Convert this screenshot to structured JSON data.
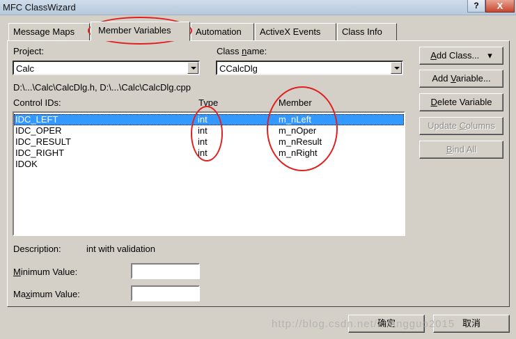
{
  "window": {
    "title": "MFC ClassWizard",
    "help_label": "?",
    "close_label": "X"
  },
  "tabs": [
    {
      "label": "Message Maps"
    },
    {
      "label": "Member Variables",
      "active": true
    },
    {
      "label": "Automation"
    },
    {
      "label": "ActiveX Events"
    },
    {
      "label": "Class Info"
    }
  ],
  "project": {
    "label": "Project:",
    "value": "Calc"
  },
  "class_name": {
    "label_prefix": "Class ",
    "label_accel": "n",
    "label_suffix": "ame:",
    "value": "CCalcDlg"
  },
  "file_path": "D:\\...\\Calc\\CalcDlg.h, D:\\...\\Calc\\CalcDlg.cpp",
  "list": {
    "headers": {
      "control_ids": "Control IDs:",
      "type": "Type",
      "member": "Member"
    },
    "rows": [
      {
        "id": "IDC_LEFT",
        "type": "int",
        "member": "m_nLeft",
        "selected": true
      },
      {
        "id": "IDC_OPER",
        "type": "int",
        "member": "m_nOper"
      },
      {
        "id": "IDC_RESULT",
        "type": "int",
        "member": "m_nResult"
      },
      {
        "id": "IDC_RIGHT",
        "type": "int",
        "member": "m_nRight"
      },
      {
        "id": "IDOK",
        "type": "",
        "member": ""
      }
    ]
  },
  "description": {
    "label": "Description:",
    "value": "int with validation"
  },
  "minimum": {
    "label_accel": "M",
    "label_rest": "inimum Value:",
    "value": ""
  },
  "maximum": {
    "label_pre": "Ma",
    "label_accel": "x",
    "label_rest": "imum Value:",
    "value": ""
  },
  "buttons": {
    "add_class": {
      "accel": "A",
      "rest": "dd Class...",
      "arrow": "▾"
    },
    "add_variable": {
      "pre": "Add ",
      "accel": "V",
      "rest": "ariable..."
    },
    "delete_variable": {
      "accel": "D",
      "rest": "elete Variable"
    },
    "update_columns": {
      "pre": "Update ",
      "accel": "C",
      "rest": "olumns"
    },
    "bind_all": {
      "accel": "B",
      "rest": "ind All"
    }
  },
  "dialog_buttons": {
    "ok": "确定",
    "cancel": "取消"
  },
  "watermark": "http://blog.csdn.net/zhangguo2015",
  "colors": {
    "selection": "#3399ff",
    "annotation": "#e02020",
    "face": "#d4d0c8"
  }
}
